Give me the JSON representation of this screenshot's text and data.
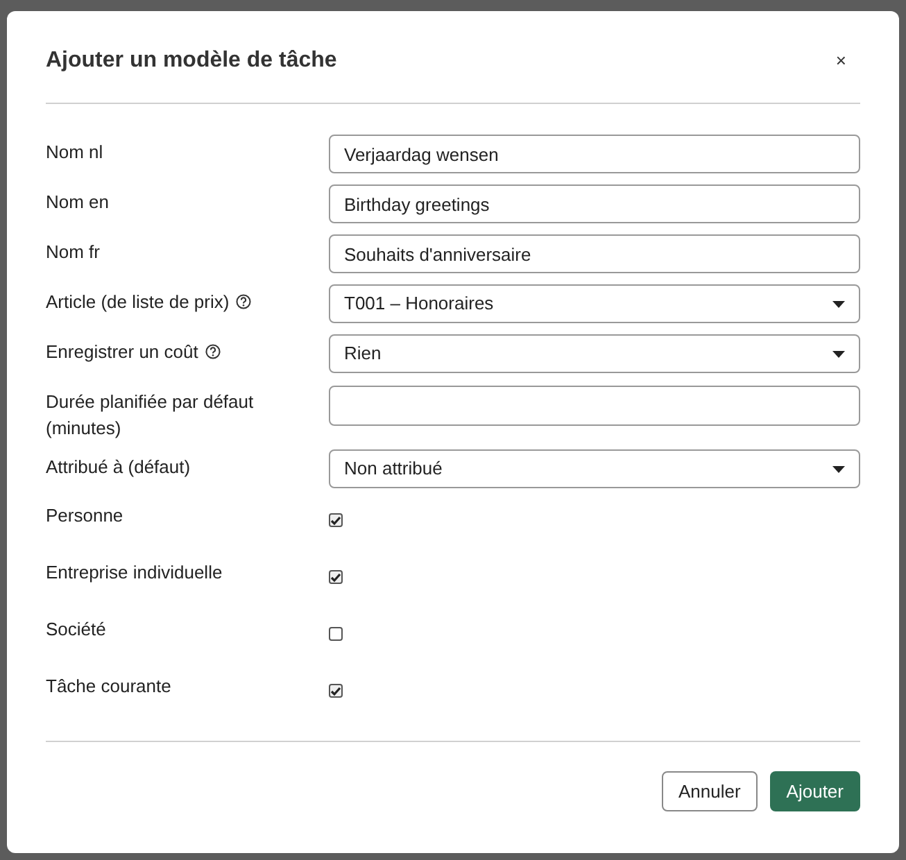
{
  "dialog": {
    "title": "Ajouter un modèle de tâche",
    "close": "×"
  },
  "fields": [
    {
      "label": "Nom nl",
      "kind": "text",
      "value": "Verjaardag wensen",
      "help": false
    },
    {
      "label": "Nom en",
      "kind": "text",
      "value": "Birthday greetings",
      "help": false
    },
    {
      "label": "Nom fr",
      "kind": "text",
      "value": "Souhaits d'anniversaire",
      "help": false
    },
    {
      "label": "Article (de liste de prix)",
      "kind": "select",
      "value": "T001 – Honoraires",
      "help": true
    },
    {
      "label": "Enregistrer un coût",
      "kind": "select",
      "value": "Rien",
      "help": true
    },
    {
      "label": "Durée planifiée par défaut (minutes)",
      "kind": "text",
      "help": false
    },
    {
      "label": "Attribué à (défaut)",
      "kind": "select",
      "value": "Non attribué",
      "help": false
    },
    {
      "label": "Personne",
      "kind": "checkbox",
      "checked": true,
      "help": false
    },
    {
      "label": "Entreprise individuelle",
      "kind": "checkbox",
      "checked": true,
      "help": false
    },
    {
      "label": "Société",
      "kind": "checkbox",
      "checked": false,
      "help": false
    },
    {
      "label": "Tâche courante",
      "kind": "checkbox",
      "checked": true,
      "help": false
    }
  ],
  "buttons": [
    {
      "label": "Annuler",
      "kind": "secondary"
    },
    {
      "label": "Ajouter",
      "kind": "primary"
    }
  ]
}
